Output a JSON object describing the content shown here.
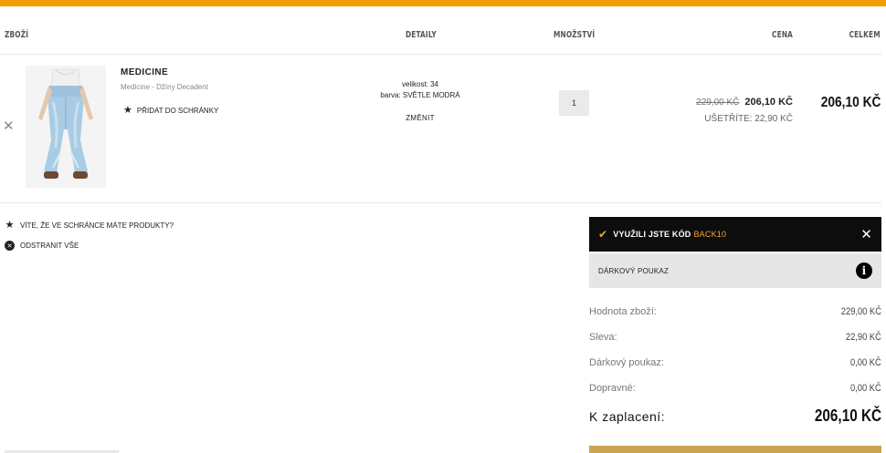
{
  "colors": {
    "accent": "#f39c00",
    "coupon_code": "#f0a830",
    "checkout": "#c9a553"
  },
  "table_headers": {
    "product": "ZBOŽÍ",
    "details": "DETAILY",
    "quantity": "MNOŽSTVÍ",
    "price": "CENA",
    "total": "CELKEM"
  },
  "item": {
    "brand": "MEDICINE",
    "name": "Medicine - Džíny Decadent",
    "wishlist_label": "PŘIDAT DO SCHRÁNKY",
    "size_line": "velikost: 34",
    "color_line": "barva: SVĚTLE MODRÁ",
    "change_label": "ZMĚNIT",
    "quantity": "1",
    "old_price": "229,00 KČ",
    "new_price": "206,10 KČ",
    "savings": "UŠETŘÍTE: 22,90 KČ",
    "total": "206,10 KČ"
  },
  "side_links": {
    "wishlist_hint": "VÍTE, ŽE VE SCHRÁNCE MÁTE PRODUKTY?",
    "remove_all": "ODSTRANIT VŠE"
  },
  "coupon": {
    "text": "VYUŽILI JSTE KÓD",
    "code": "BACK10"
  },
  "voucher": {
    "label": "DÁRKOVÝ POUKAZ"
  },
  "summary": {
    "goods_label": "Hodnota zboží:",
    "goods_value": "229,00 KČ",
    "discount_label": "Sleva:",
    "discount_value": "22,90 KČ",
    "voucher_label": "Dárkový poukaz:",
    "voucher_value": "0,00 KČ",
    "shipping_label": "Dopravné:",
    "shipping_value": "0,00 KČ",
    "total_label": "K zaplacení:",
    "total_value": "206,10 KČ"
  }
}
